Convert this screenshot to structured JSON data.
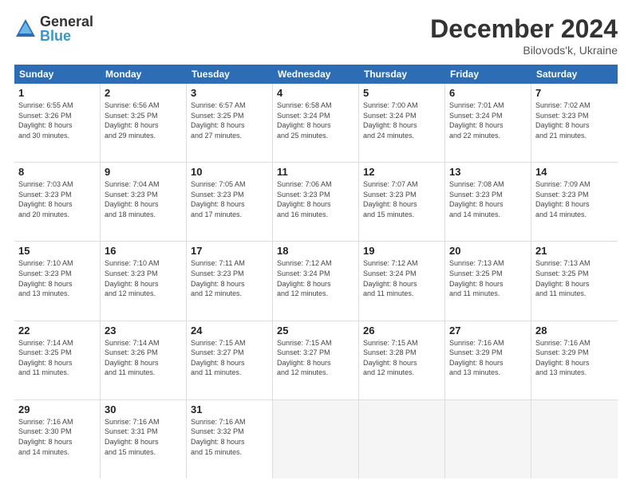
{
  "logo": {
    "general": "General",
    "blue": "Blue"
  },
  "title": "December 2024",
  "subtitle": "Bilovods'k, Ukraine",
  "header_days": [
    "Sunday",
    "Monday",
    "Tuesday",
    "Wednesday",
    "Thursday",
    "Friday",
    "Saturday"
  ],
  "weeks": [
    [
      {
        "day": "1",
        "info": "Sunrise: 6:55 AM\nSunset: 3:26 PM\nDaylight: 8 hours\nand 30 minutes."
      },
      {
        "day": "2",
        "info": "Sunrise: 6:56 AM\nSunset: 3:25 PM\nDaylight: 8 hours\nand 29 minutes."
      },
      {
        "day": "3",
        "info": "Sunrise: 6:57 AM\nSunset: 3:25 PM\nDaylight: 8 hours\nand 27 minutes."
      },
      {
        "day": "4",
        "info": "Sunrise: 6:58 AM\nSunset: 3:24 PM\nDaylight: 8 hours\nand 25 minutes."
      },
      {
        "day": "5",
        "info": "Sunrise: 7:00 AM\nSunset: 3:24 PM\nDaylight: 8 hours\nand 24 minutes."
      },
      {
        "day": "6",
        "info": "Sunrise: 7:01 AM\nSunset: 3:24 PM\nDaylight: 8 hours\nand 22 minutes."
      },
      {
        "day": "7",
        "info": "Sunrise: 7:02 AM\nSunset: 3:23 PM\nDaylight: 8 hours\nand 21 minutes."
      }
    ],
    [
      {
        "day": "8",
        "info": "Sunrise: 7:03 AM\nSunset: 3:23 PM\nDaylight: 8 hours\nand 20 minutes."
      },
      {
        "day": "9",
        "info": "Sunrise: 7:04 AM\nSunset: 3:23 PM\nDaylight: 8 hours\nand 18 minutes."
      },
      {
        "day": "10",
        "info": "Sunrise: 7:05 AM\nSunset: 3:23 PM\nDaylight: 8 hours\nand 17 minutes."
      },
      {
        "day": "11",
        "info": "Sunrise: 7:06 AM\nSunset: 3:23 PM\nDaylight: 8 hours\nand 16 minutes."
      },
      {
        "day": "12",
        "info": "Sunrise: 7:07 AM\nSunset: 3:23 PM\nDaylight: 8 hours\nand 15 minutes."
      },
      {
        "day": "13",
        "info": "Sunrise: 7:08 AM\nSunset: 3:23 PM\nDaylight: 8 hours\nand 14 minutes."
      },
      {
        "day": "14",
        "info": "Sunrise: 7:09 AM\nSunset: 3:23 PM\nDaylight: 8 hours\nand 14 minutes."
      }
    ],
    [
      {
        "day": "15",
        "info": "Sunrise: 7:10 AM\nSunset: 3:23 PM\nDaylight: 8 hours\nand 13 minutes."
      },
      {
        "day": "16",
        "info": "Sunrise: 7:10 AM\nSunset: 3:23 PM\nDaylight: 8 hours\nand 12 minutes."
      },
      {
        "day": "17",
        "info": "Sunrise: 7:11 AM\nSunset: 3:23 PM\nDaylight: 8 hours\nand 12 minutes."
      },
      {
        "day": "18",
        "info": "Sunrise: 7:12 AM\nSunset: 3:24 PM\nDaylight: 8 hours\nand 12 minutes."
      },
      {
        "day": "19",
        "info": "Sunrise: 7:12 AM\nSunset: 3:24 PM\nDaylight: 8 hours\nand 11 minutes."
      },
      {
        "day": "20",
        "info": "Sunrise: 7:13 AM\nSunset: 3:25 PM\nDaylight: 8 hours\nand 11 minutes."
      },
      {
        "day": "21",
        "info": "Sunrise: 7:13 AM\nSunset: 3:25 PM\nDaylight: 8 hours\nand 11 minutes."
      }
    ],
    [
      {
        "day": "22",
        "info": "Sunrise: 7:14 AM\nSunset: 3:25 PM\nDaylight: 8 hours\nand 11 minutes."
      },
      {
        "day": "23",
        "info": "Sunrise: 7:14 AM\nSunset: 3:26 PM\nDaylight: 8 hours\nand 11 minutes."
      },
      {
        "day": "24",
        "info": "Sunrise: 7:15 AM\nSunset: 3:27 PM\nDaylight: 8 hours\nand 11 minutes."
      },
      {
        "day": "25",
        "info": "Sunrise: 7:15 AM\nSunset: 3:27 PM\nDaylight: 8 hours\nand 12 minutes."
      },
      {
        "day": "26",
        "info": "Sunrise: 7:15 AM\nSunset: 3:28 PM\nDaylight: 8 hours\nand 12 minutes."
      },
      {
        "day": "27",
        "info": "Sunrise: 7:16 AM\nSunset: 3:29 PM\nDaylight: 8 hours\nand 13 minutes."
      },
      {
        "day": "28",
        "info": "Sunrise: 7:16 AM\nSunset: 3:29 PM\nDaylight: 8 hours\nand 13 minutes."
      }
    ],
    [
      {
        "day": "29",
        "info": "Sunrise: 7:16 AM\nSunset: 3:30 PM\nDaylight: 8 hours\nand 14 minutes."
      },
      {
        "day": "30",
        "info": "Sunrise: 7:16 AM\nSunset: 3:31 PM\nDaylight: 8 hours\nand 15 minutes."
      },
      {
        "day": "31",
        "info": "Sunrise: 7:16 AM\nSunset: 3:32 PM\nDaylight: 8 hours\nand 15 minutes."
      },
      {
        "day": "",
        "info": ""
      },
      {
        "day": "",
        "info": ""
      },
      {
        "day": "",
        "info": ""
      },
      {
        "day": "",
        "info": ""
      }
    ]
  ]
}
